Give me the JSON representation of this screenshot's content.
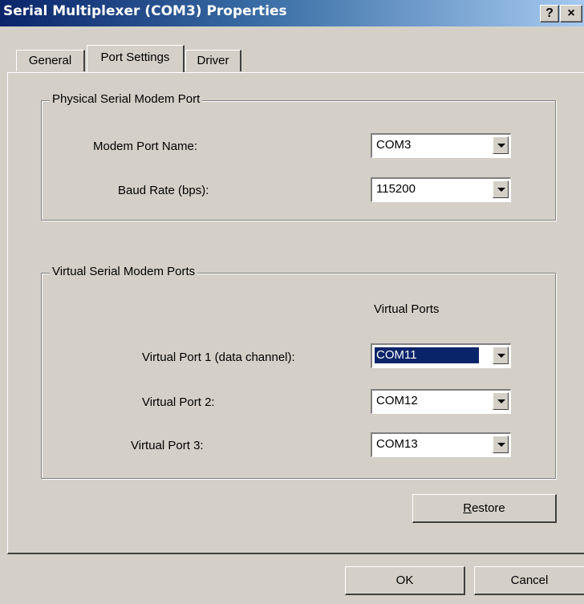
{
  "window": {
    "title": "Serial Multiplexer (COM3) Properties",
    "help_label": "?",
    "close_label": "×"
  },
  "tabs": [
    {
      "label": "General",
      "active": false
    },
    {
      "label": "Port Settings",
      "active": true
    },
    {
      "label": "Driver",
      "active": false
    }
  ],
  "physical_group": {
    "legend": "Physical Serial Modem Port",
    "modem_port_label": "Modem Port Name:",
    "modem_port_value": "COM3",
    "baud_rate_label": "Baud Rate (bps):",
    "baud_rate_value": "115200"
  },
  "virtual_group": {
    "legend": "Virtual Serial Modem Ports",
    "column_header": "Virtual Ports",
    "ports": [
      {
        "label": "Virtual Port 1 (data channel):",
        "value": "COM11",
        "focused": true
      },
      {
        "label": "Virtual Port 2:",
        "value": "COM12",
        "focused": false
      },
      {
        "label": "Virtual Port 3:",
        "value": "COM13",
        "focused": false
      }
    ]
  },
  "buttons": {
    "restore_label": "Restore",
    "restore_mnemonic": "R",
    "ok_label": "OK",
    "cancel_label": "Cancel"
  },
  "colors": {
    "titlebar_start": "#0a246a",
    "titlebar_end": "#a6caf0",
    "face": "#d4d0c8",
    "selection": "#0a246a"
  },
  "icons": {
    "dropdown": "chevron-down-icon",
    "help": "help-icon",
    "close": "close-icon"
  }
}
